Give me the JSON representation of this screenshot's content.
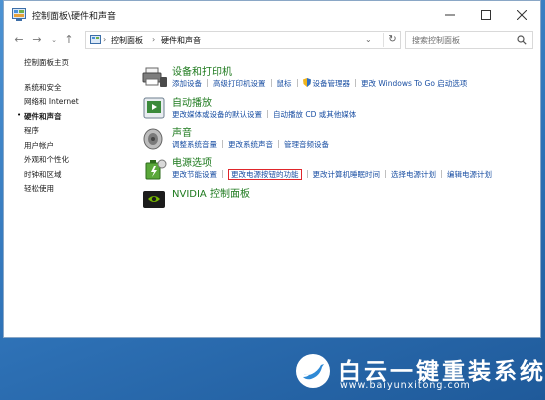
{
  "window": {
    "title": "控制面板\\硬件和声音"
  },
  "address": {
    "crumbs": [
      "控制面板",
      "硬件和声音"
    ],
    "search_placeholder": "搜索控制面板"
  },
  "sidebar": {
    "items": [
      {
        "label": "控制面板主页",
        "active": false
      },
      {
        "label": "系统和安全",
        "active": false
      },
      {
        "label": "网络和 Internet",
        "active": false
      },
      {
        "label": "硬件和声音",
        "active": true
      },
      {
        "label": "程序",
        "active": false
      },
      {
        "label": "用户帐户",
        "active": false
      },
      {
        "label": "外观和个性化",
        "active": false
      },
      {
        "label": "时钟和区域",
        "active": false
      },
      {
        "label": "轻松使用",
        "active": false
      }
    ]
  },
  "categories": [
    {
      "title": "设备和打印机",
      "links": [
        "添加设备",
        "高级打印机设置",
        "鼠标",
        "设备管理器",
        "更改 Windows To Go 启动选项"
      ]
    },
    {
      "title": "自动播放",
      "links": [
        "更改媒体或设备的默认设置",
        "自动播放 CD 或其他媒体"
      ]
    },
    {
      "title": "声音",
      "links": [
        "调整系统音量",
        "更改系统声音",
        "管理音频设备"
      ]
    },
    {
      "title": "电源选项",
      "links": [
        "更改节能设置",
        "更改电源按钮的功能",
        "更改计算机睡眠时间",
        "选择电源计划",
        "编辑电源计划"
      ]
    },
    {
      "title": "NVIDIA 控制面板",
      "links": []
    }
  ],
  "watermark": {
    "brand": "白云一键重装系统",
    "url": "www.baiyunxitong.com"
  },
  "colors": {
    "link": "#1a4fa3",
    "category_title": "#1e7a1e",
    "highlight_box": "#e0262b"
  }
}
